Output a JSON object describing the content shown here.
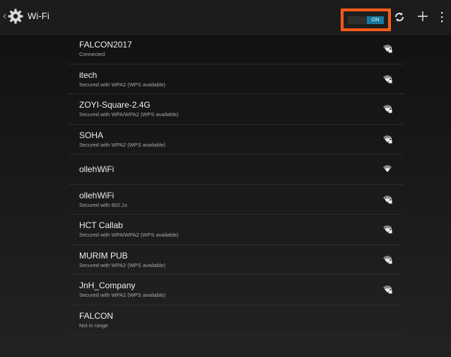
{
  "action_bar": {
    "title": "Wi-Fi",
    "toggle_label": "ON",
    "icons": [
      "up-caret",
      "settings-gear-icon",
      "wps-scan-icon",
      "add-network-icon",
      "overflow-menu-icon"
    ],
    "highlight_color": "#ff5a1a",
    "toggle_color": "#1979a0"
  },
  "networks": [
    {
      "ssid": "FALCON2017",
      "status": "Connected",
      "signal": "secured"
    },
    {
      "ssid": "itech",
      "status": "Secured with WPA2 (WPS available)",
      "signal": "secured"
    },
    {
      "ssid": "ZOYI-Square-2.4G",
      "status": "Secured with WPA/WPA2 (WPS available)",
      "signal": "secured"
    },
    {
      "ssid": "SOHA",
      "status": "Secured with WPA2 (WPS available)",
      "signal": "secured"
    },
    {
      "ssid": "ollehWiFi",
      "status": "",
      "signal": "open"
    },
    {
      "ssid": "ollehWiFi",
      "status": "Secured with 802.1x",
      "signal": "secured"
    },
    {
      "ssid": "HCT Callab",
      "status": "Secured with WPA/WPA2 (WPS available)",
      "signal": "secured"
    },
    {
      "ssid": "MURIM PUB",
      "status": "Secured with WPA2 (WPS available)",
      "signal": "secured"
    },
    {
      "ssid": "JnH_Company",
      "status": "Secured with WPA2 (WPS available)",
      "signal": "secured"
    },
    {
      "ssid": "FALCON",
      "status": "Not in range",
      "signal": "none"
    }
  ]
}
